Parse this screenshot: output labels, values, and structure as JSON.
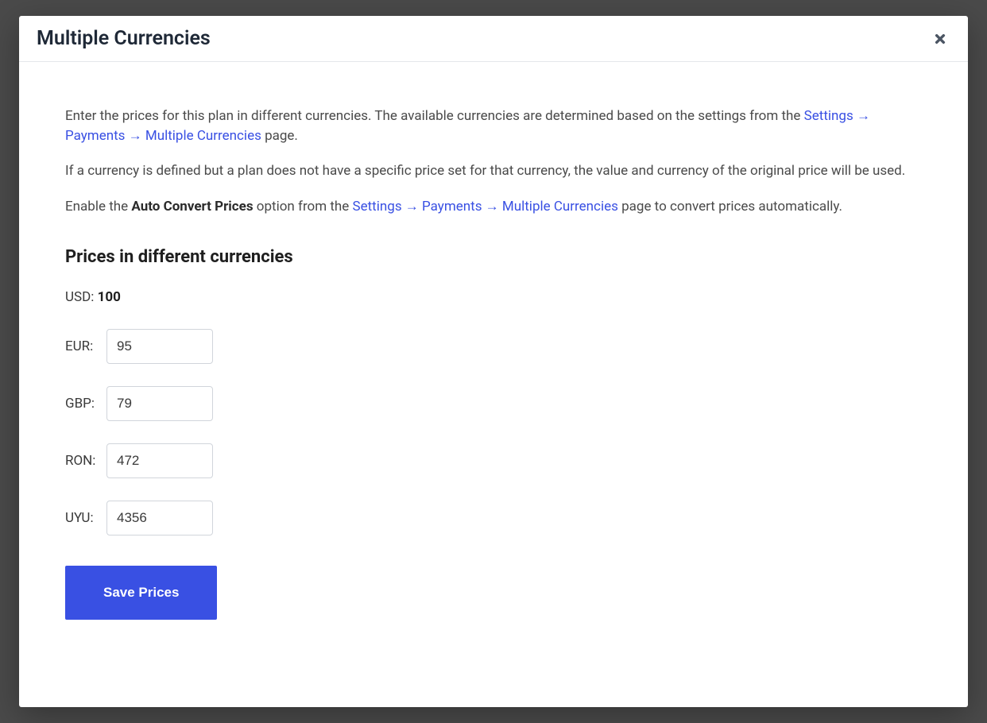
{
  "modal": {
    "title": "Multiple Currencies",
    "intro": {
      "p1_prefix": "Enter the prices for this plan in different currencies. The available currencies are determined based on the settings from the ",
      "p1_link": "Settings → Payments → Multiple Currencies",
      "p1_suffix": " page.",
      "p2": "If a currency is defined but a plan does not have a specific price set for that currency, the value and currency of the original price will be used.",
      "p3_prefix": "Enable the ",
      "p3_bold": "Auto Convert Prices",
      "p3_middle": " option from the ",
      "p3_link": "Settings → Payments → Multiple Currencies",
      "p3_suffix": " page to convert prices automatically."
    },
    "section_heading": "Prices in different currencies",
    "base": {
      "label": "USD:",
      "value": "100"
    },
    "rows": {
      "eur": {
        "label": "EUR:",
        "value": "95"
      },
      "gbp": {
        "label": "GBP:",
        "value": "79"
      },
      "ron": {
        "label": "RON:",
        "value": "472"
      },
      "uyu": {
        "label": "UYU:",
        "value": "4356"
      }
    },
    "save_label": "Save Prices"
  }
}
